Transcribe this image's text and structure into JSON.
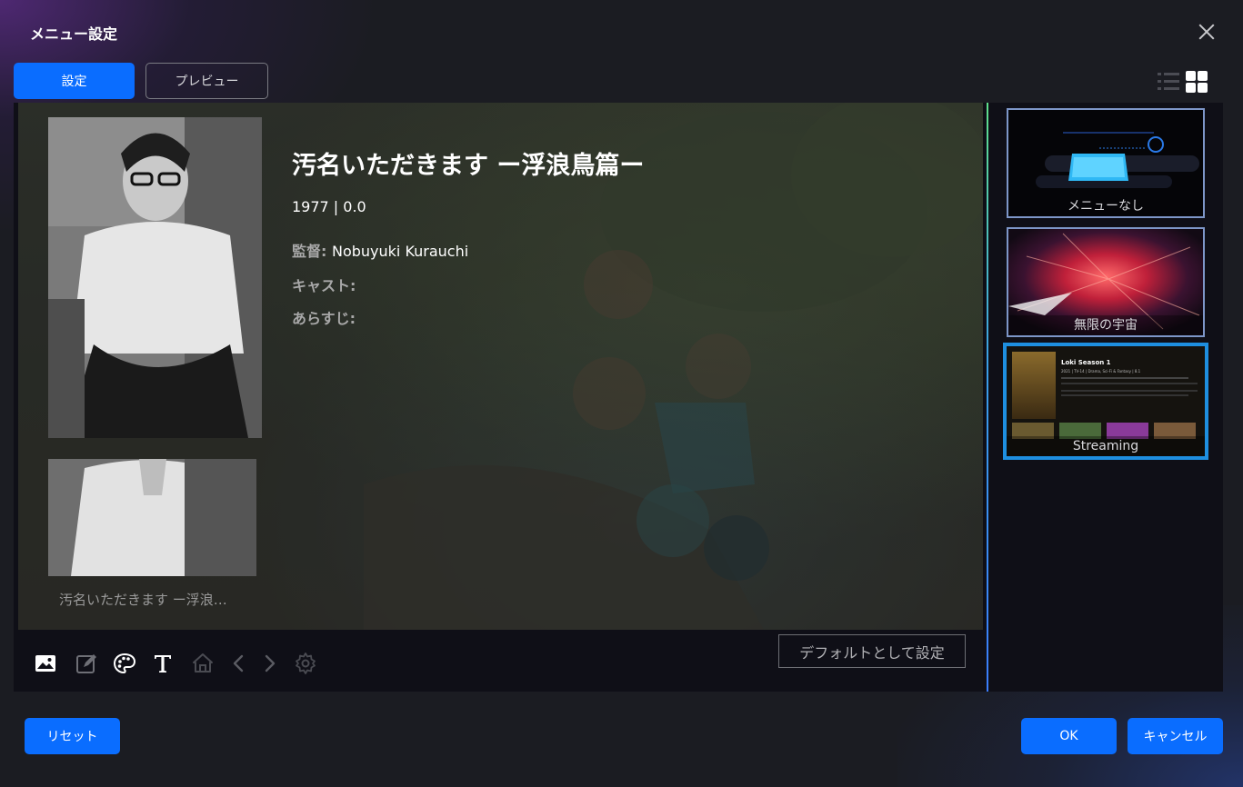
{
  "dialog": {
    "title": "メニュー設定"
  },
  "tabs": {
    "settings": "設定",
    "preview": "プレビュー"
  },
  "movie": {
    "title": "汚名いただきます ー浮浪鳥篇ー",
    "meta": "1977 | 0.0",
    "director_label": "監督:",
    "director_value": "Nobuyuki Kurauchi",
    "cast_label": "キャスト:",
    "synopsis_label": "あらすじ:",
    "caption": "汚名いただきます ー浮浪…"
  },
  "toolbar": {
    "icons": [
      "image-icon",
      "edit-icon",
      "palette-icon",
      "text-icon",
      "home-icon",
      "chevron-left-icon",
      "chevron-right-icon",
      "gear-icon"
    ],
    "default_button": "デフォルトとして設定"
  },
  "templates": [
    {
      "label": "メニューなし"
    },
    {
      "label": "無限の宇宙"
    },
    {
      "label": "Streaming",
      "selected": true
    }
  ],
  "template_thumb": {
    "title": "Loki Season 1",
    "meta": "2021 | TV-14 | Drama, Sci-Fi & Fantasy | 8.1"
  },
  "footer": {
    "reset": "リセット",
    "ok": "OK",
    "cancel": "キャンセル"
  },
  "colors": {
    "accent": "#0a6dff",
    "selected_border": "#1e8fe0",
    "background": "#1b1c22"
  }
}
